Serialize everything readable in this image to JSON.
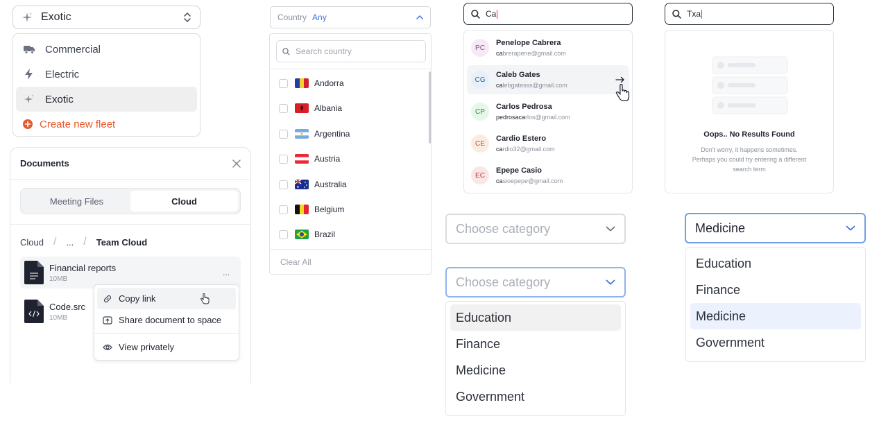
{
  "fleet": {
    "selected": "Exotic",
    "items": [
      {
        "label": "Commercial",
        "icon": "truck-icon"
      },
      {
        "label": "Electric",
        "icon": "lightning-icon"
      },
      {
        "label": "Exotic",
        "icon": "sparkle-icon"
      }
    ],
    "create_label": "Create new fleet"
  },
  "documents": {
    "title": "Documents",
    "tabs": [
      "Meeting Files",
      "Cloud"
    ],
    "active_tab": "Cloud",
    "breadcrumb": [
      "Cloud",
      "...",
      "Team Cloud"
    ],
    "files": [
      {
        "name": "Financial reports",
        "size": "10MB",
        "icon": "document-icon"
      },
      {
        "name": "Code.src",
        "size": "10MB",
        "icon": "code-file-icon"
      }
    ],
    "more_label": "...",
    "context_menu": [
      "Copy link",
      "Share document to space",
      "View privately"
    ]
  },
  "country": {
    "label": "Country",
    "value": "Any",
    "search_placeholder": "Search country",
    "items": [
      "Andorra",
      "Albania",
      "Argentina",
      "Austria",
      "Australia",
      "Belgium",
      "Brazil"
    ],
    "clear_label": "Clear All"
  },
  "contact_search": {
    "query": "Ca",
    "results": [
      {
        "initials": "PC",
        "name": "Penelope Cabrera",
        "email_hl": "ca",
        "email_rest": "brerapene@gmail.com",
        "bg": "#f6e9f6",
        "fg": "#9b3ea0"
      },
      {
        "initials": "CG",
        "name": "Caleb Gates",
        "email_hl": "ca",
        "email_rest": "lebgatesss@gmail.com",
        "bg": "#e7f0f9",
        "fg": "#2f6aa8"
      },
      {
        "initials": "CP",
        "name": "Carlos Pedrosa",
        "email_hl": "pedrosaca",
        "email_rest": "rlos@gmail.com",
        "bg": "#e6f6ea",
        "fg": "#2d8a45"
      },
      {
        "initials": "CE",
        "name": "Cardio Estero",
        "email_hl": "ca",
        "email_rest": "rdio32@gmail.com",
        "bg": "#fbece3",
        "fg": "#b4592a"
      },
      {
        "initials": "EC",
        "name": "Epepe Casio",
        "email_hl": "ca",
        "email_rest": "sioepepe@gmail.com",
        "bg": "#fbe6e6",
        "fg": "#b43a3a"
      }
    ]
  },
  "empty_search": {
    "query": "Txa",
    "title": "Oops.. No Results Found",
    "message": "Don't worry, it happens sometimes. Perhaps you could try entering a different search term"
  },
  "category": {
    "placeholder": "Choose category",
    "options": [
      "Education",
      "Finance",
      "Medicine",
      "Government"
    ],
    "selected": "Medicine"
  },
  "colors": {
    "accent_orange": "#e8572c",
    "link_blue": "#3f6fe0",
    "focus_blue": "#6f9ee8"
  }
}
